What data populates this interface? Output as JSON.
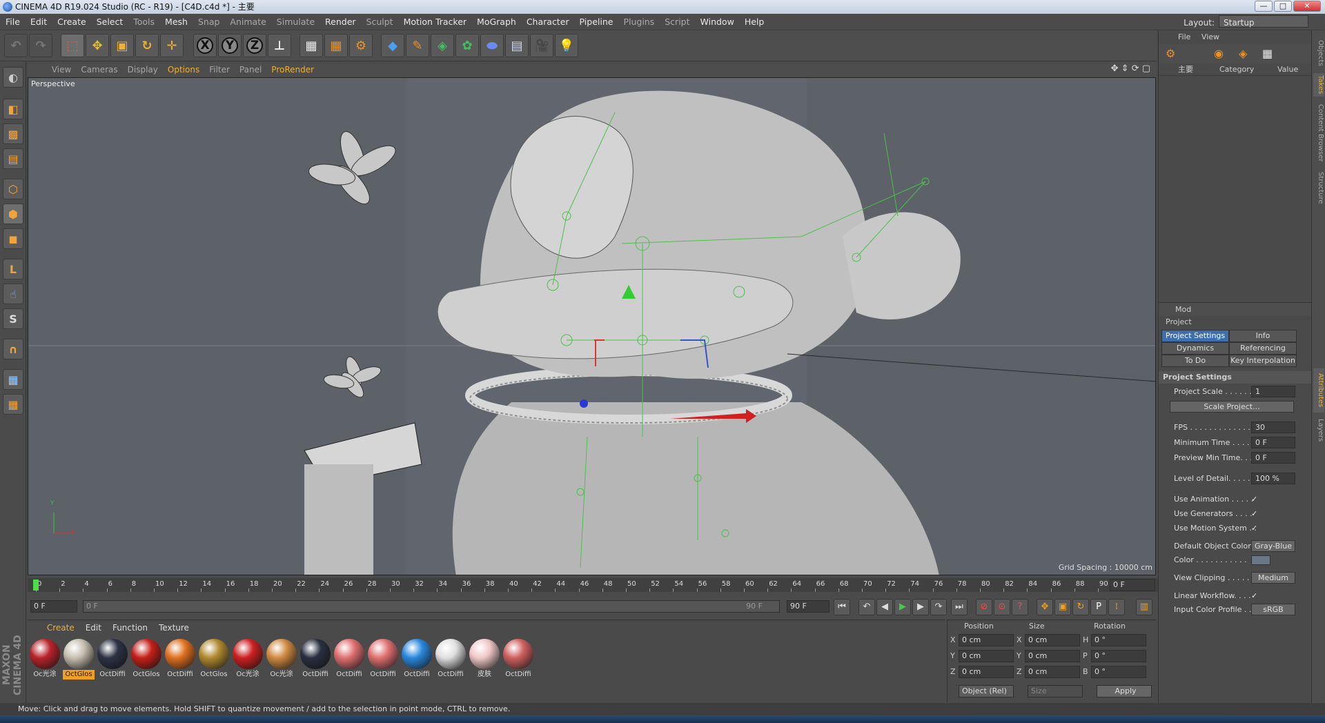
{
  "window": {
    "title": "CINEMA 4D R19.024 Studio (RC - R19) - [C4D.c4d *] - 主要",
    "minimize": "—",
    "maximize": "□",
    "close": "✕"
  },
  "menu": {
    "items": [
      "File",
      "Edit",
      "Create",
      "Select",
      "Tools",
      "Mesh",
      "Snap",
      "Animate",
      "Simulate",
      "Render",
      "Sculpt",
      "Motion Tracker",
      "MoGraph",
      "Character",
      "Pipeline",
      "Plugins",
      "Script",
      "Window",
      "Help"
    ],
    "layout_label": "Layout:",
    "layout_value": "Startup"
  },
  "toolbar": {
    "axis_x": "X",
    "axis_y": "Y",
    "axis_z": "Z"
  },
  "viewport": {
    "menu": [
      "View",
      "Cameras",
      "Display",
      "Options",
      "Filter",
      "Panel",
      "ProRender"
    ],
    "active_menu": "Options",
    "label": "Perspective",
    "grid_spacing": "Grid Spacing : 10000 cm",
    "axis_y": "Y",
    "axis_x": "X"
  },
  "timeline": {
    "ticks": [
      "0",
      "2",
      "4",
      "6",
      "8",
      "10",
      "12",
      "14",
      "16",
      "18",
      "20",
      "22",
      "24",
      "26",
      "28",
      "30",
      "32",
      "34",
      "36",
      "38",
      "40",
      "42",
      "44",
      "46",
      "48",
      "50",
      "52",
      "54",
      "56",
      "58",
      "60",
      "62",
      "64",
      "66",
      "68",
      "70",
      "72",
      "74",
      "76",
      "78",
      "80",
      "82",
      "84",
      "86",
      "88",
      "90"
    ],
    "current_frame_display": "0 F"
  },
  "transport": {
    "start": "0 F",
    "range_start": "0 F",
    "range_end": "90 F",
    "end": "90 F"
  },
  "materials": {
    "menu": [
      "Create",
      "Edit",
      "Function",
      "Texture"
    ],
    "active_menu": "Create",
    "items": [
      {
        "label": "Oc光涂",
        "color": "#b8242a",
        "selected": false
      },
      {
        "label": "OctGlos",
        "color": "#c8c0b0",
        "selected": true
      },
      {
        "label": "OctDiffi",
        "color": "#2c3344",
        "selected": false
      },
      {
        "label": "OctGlos",
        "color": "#c42018",
        "selected": false
      },
      {
        "label": "OctDiffi",
        "color": "#e07020",
        "selected": false
      },
      {
        "label": "OctGlos",
        "color": "#b08a30",
        "selected": false
      },
      {
        "label": "Oc光涂",
        "color": "#cc2020",
        "selected": false
      },
      {
        "label": "Oc光涂",
        "color": "#d08a40",
        "selected": false
      },
      {
        "label": "OctDiffi",
        "color": "#2a3040",
        "selected": false
      },
      {
        "label": "OctDiffi",
        "color": "#e07070",
        "selected": false
      },
      {
        "label": "OctDiffi",
        "color": "#e07070",
        "selected": false
      },
      {
        "label": "OctDiffi",
        "color": "#2a88dd",
        "selected": false
      },
      {
        "label": "OctDiffi",
        "color": "#e0e0e0",
        "selected": false
      },
      {
        "label": "皮肤",
        "color": "#f0c8c8",
        "selected": false
      },
      {
        "label": "OctDiffi",
        "color": "#d06060",
        "selected": false
      }
    ]
  },
  "coords": {
    "headers": [
      "Position",
      "Size",
      "Rotation"
    ],
    "rows": [
      {
        "a": "X",
        "pos": "0 cm",
        "b": "X",
        "size": "0 cm",
        "c": "H",
        "rot": "0 °"
      },
      {
        "a": "Y",
        "pos": "0 cm",
        "b": "Y",
        "size": "0 cm",
        "c": "P",
        "rot": "0 °"
      },
      {
        "a": "Z",
        "pos": "0 cm",
        "b": "Z",
        "size": "0 cm",
        "c": "B",
        "rot": "0 °"
      }
    ],
    "mode": "Object (Rel)",
    "size_mode": "Size",
    "apply": "Apply"
  },
  "status": "Move: Click and drag to move elements. Hold SHIFT to quantize movement / add to the selection in point mode, CTRL to remove.",
  "objects_panel": {
    "menu": [
      "File",
      "View"
    ],
    "col_name": "主要",
    "col_category": "Category",
    "col_value": "Value"
  },
  "attributes": {
    "mode": "Mod",
    "object": "Project",
    "tabs": [
      "Project Settings",
      "Info",
      "Dynamics",
      "Referencing",
      "To Do",
      "Key Interpolation"
    ],
    "active_tab": "Project Settings",
    "section": "Project Settings",
    "project_scale_label": "Project Scale . . . . . .",
    "project_scale": "1",
    "scale_button": "Scale Project...",
    "fps_label": "FPS . . . . . . . . . . . . .",
    "fps": "30",
    "min_time_label": "Minimum Time . . . . .",
    "min_time": "0 F",
    "preview_min_label": "Preview Min Time. . .",
    "preview_min": "0 F",
    "lod_label": "Level of Detail. . . . .",
    "lod": "100 %",
    "use_animation": "Use Animation . . . . .",
    "use_generators": "Use Generators . . . .",
    "use_motion": "Use Motion System . .",
    "check": "✓",
    "default_color_label": "Default Object Color",
    "default_color": "Gray-Blue",
    "color_label": "Color . . . . . . . . . . .",
    "view_clipping_label": "View Clipping . . . . .",
    "view_clipping": "Medium",
    "linear_workflow": "Linear Workflow. . . .",
    "input_profile_label": "Input Color Profile . .",
    "input_profile": "sRGB"
  },
  "side_tabs": [
    "Objects",
    "Takes",
    "Content Browser",
    "Structure",
    "Attributes",
    "Layers"
  ],
  "brand": "MAXON CINEMA 4D"
}
